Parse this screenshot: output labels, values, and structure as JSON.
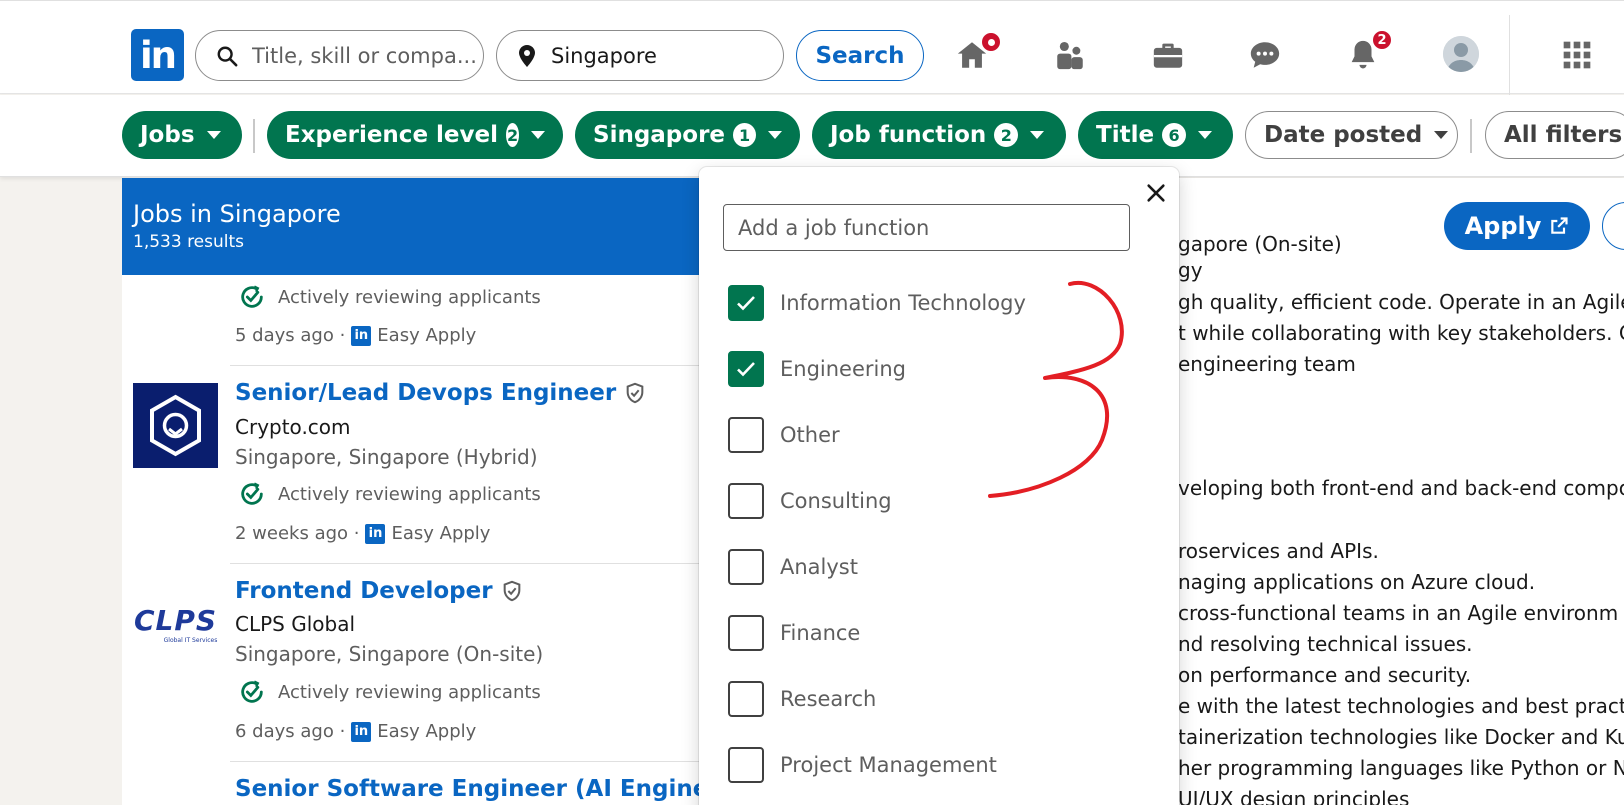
{
  "nav": {
    "search_placeholder": "Title, skill or compa...",
    "location_value": "Singapore",
    "search_label": "Search",
    "notifications_count": "2",
    "icons": [
      "home-icon",
      "my-network-icon",
      "jobs-icon",
      "messaging-icon",
      "notifications-icon",
      "apps-grid-icon"
    ]
  },
  "filters": {
    "jobs": "Jobs",
    "experience": "Experience level",
    "experience_count": "2",
    "location": "Singapore",
    "location_count": "1",
    "job_function": "Job function",
    "job_function_count": "2",
    "title": "Title",
    "title_count": "6",
    "date_posted": "Date posted",
    "all_filters": "All filters"
  },
  "list": {
    "header_title": "Jobs in Singapore",
    "header_results": "1,533 results",
    "partial_status": "Actively reviewing applicants",
    "partial_posted": "5 days ago ·",
    "easy_apply": "Easy Apply",
    "jobs": [
      {
        "title": "Senior/Lead Devops Engineer",
        "company": "Crypto.com",
        "location": "Singapore, Singapore (Hybrid)",
        "status": "Actively reviewing applicants",
        "posted": "2 weeks ago ·"
      },
      {
        "title": "Frontend Developer",
        "company": "CLPS Global",
        "location": "Singapore, Singapore (On-site)",
        "status": "Actively reviewing applicants",
        "posted": "6 days ago ·"
      },
      {
        "title": "Senior Software Engineer (AI Engineer"
      }
    ],
    "clps_logo": "CLPS",
    "clps_sub": "Global IT Services"
  },
  "detail": {
    "apply_label": "Apply",
    "location_fragment": "gapore (On-site)",
    "lines": [
      "gy",
      "gh quality, efficient code. Operate in an Agile",
      "t while collaborating with key stakeholders. C",
      "engineering team",
      "veloping both front-end and back-end compo",
      "roservices and APIs.",
      "naging applications on Azure cloud.",
      " cross-functional teams in an Agile environm",
      "nd resolving technical issues.",
      "on performance and security.",
      "e with the latest technologies and best practi",
      "tainerization technologies like Docker and Ku",
      "her programming languages like Python or N",
      "UI/UX design principles"
    ]
  },
  "dropdown": {
    "placeholder": "Add a job function",
    "options": [
      {
        "label": "Information Technology",
        "checked": true
      },
      {
        "label": "Engineering",
        "checked": true
      },
      {
        "label": "Other",
        "checked": false
      },
      {
        "label": "Consulting",
        "checked": false
      },
      {
        "label": "Analyst",
        "checked": false
      },
      {
        "label": "Finance",
        "checked": false
      },
      {
        "label": "Research",
        "checked": false
      },
      {
        "label": "Project Management",
        "checked": false
      }
    ]
  },
  "colors": {
    "brand_blue": "#0a66c2",
    "filter_green": "#01754f",
    "badge_red": "#cb112d",
    "annotation_red": "#e31e24"
  }
}
